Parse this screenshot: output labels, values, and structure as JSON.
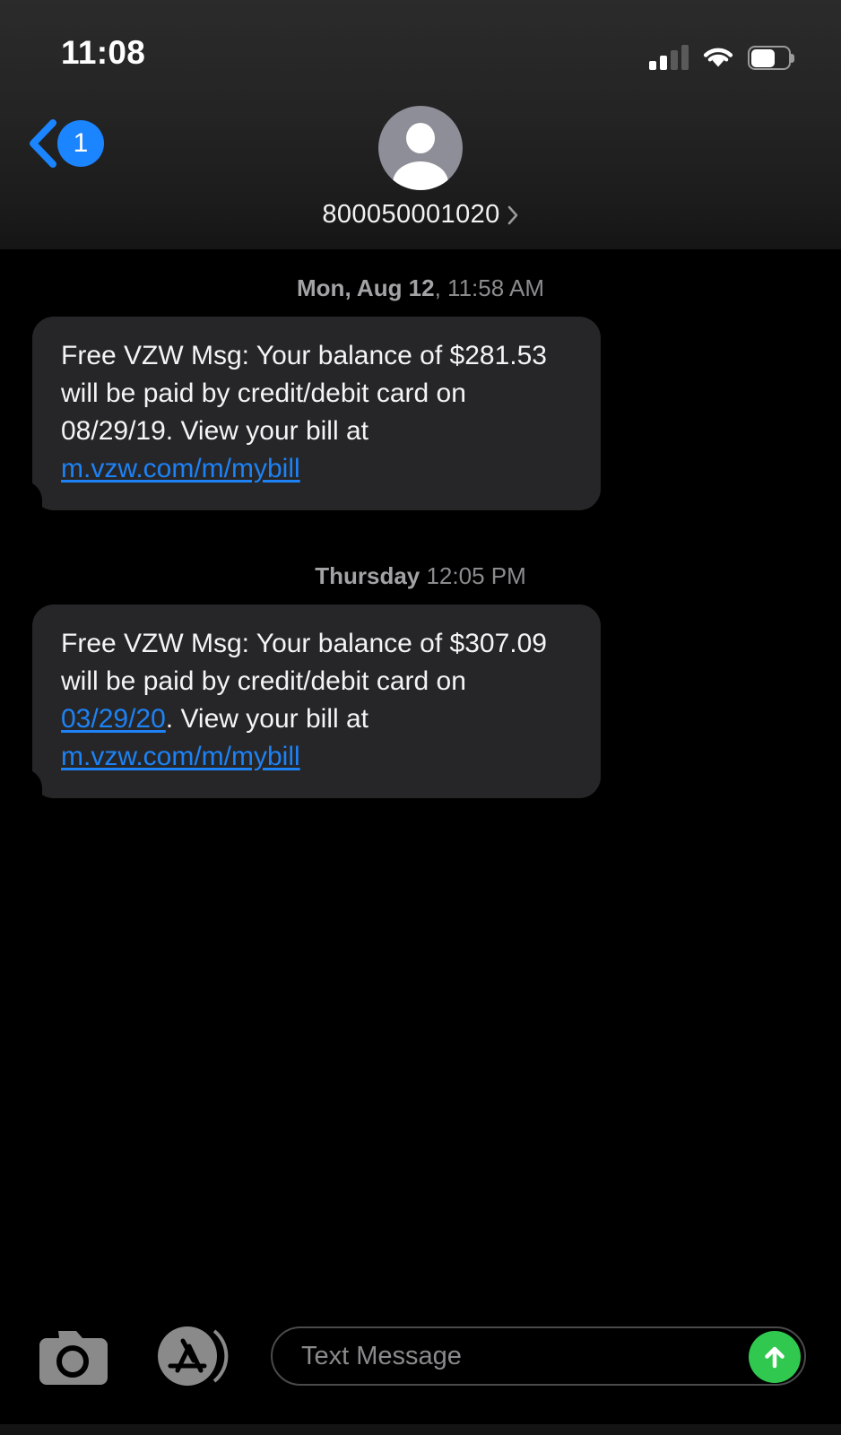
{
  "statusbar": {
    "time": "11:08",
    "signal_icon": "cellular-signal-icon",
    "signal_bars_filled": 2,
    "signal_bars_total": 4,
    "wifi_icon": "wifi-icon",
    "battery_icon": "battery-icon",
    "battery_percent": 60
  },
  "header": {
    "back_icon": "chevron-left-icon",
    "back_badge_count": "1",
    "avatar_icon": "person-avatar-icon",
    "contact_name": "800050001020",
    "contact_detail_icon": "chevron-right-icon",
    "accent_color": "#1b84ff"
  },
  "conversation": {
    "messages": [
      {
        "timestamp_day": "Mon, Aug 12",
        "timestamp_time": ", 11:58 AM",
        "text_before_link": "Free VZW Msg: Your balance of $281.53 will be paid by credit/debit card on 08/29/19. View your bill at ",
        "link_text": "m.vzw.com/m/mybill",
        "link_color": "#1d82f5",
        "bubble_color": "#262628",
        "side": "incoming"
      },
      {
        "timestamp_day": "Thursday",
        "timestamp_time": " 12:05 PM",
        "text_part1": "Free VZW Msg: Your balance of $307.09 will be paid by credit/debit card on ",
        "date_link": "03/29/20",
        "text_part2": ". View your bill at ",
        "link_text": "m.vzw.com/m/mybill",
        "link_color": "#1d82f5",
        "bubble_color": "#262628",
        "side": "incoming"
      }
    ]
  },
  "bottombar": {
    "camera_icon": "camera-icon",
    "appstore_icon": "app-store-icon",
    "input_placeholder": "Text Message",
    "input_value": "",
    "send_icon": "send-arrow-up-icon",
    "send_color": "#30c84f"
  }
}
